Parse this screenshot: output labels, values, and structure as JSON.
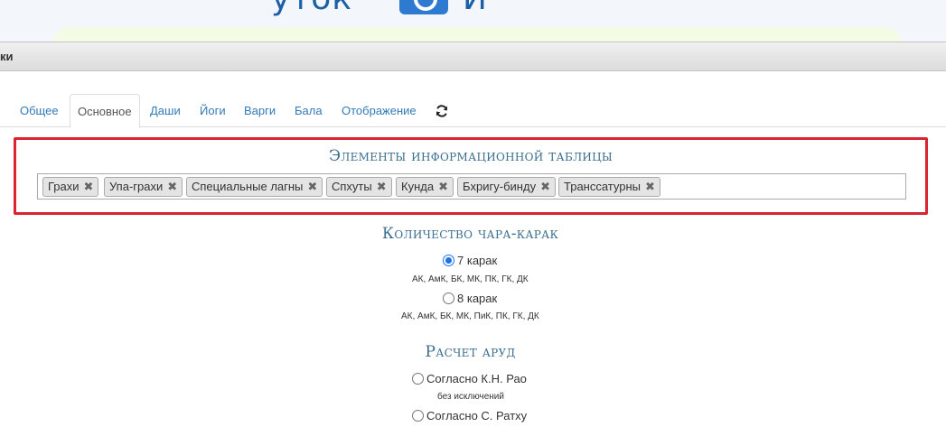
{
  "banner": {
    "brand_left": "уток",
    "brand_right": "И"
  },
  "dialog": {
    "title": "ки"
  },
  "tabs": {
    "left_fragment": "-",
    "items": [
      {
        "label": "Общее"
      },
      {
        "label": "Основное"
      },
      {
        "label": "Даши"
      },
      {
        "label": "Йоги"
      },
      {
        "label": "Варги"
      },
      {
        "label": "Бала"
      },
      {
        "label": "Отображение"
      }
    ],
    "active_index": 1
  },
  "info_table": {
    "heading": "Элементы информационной таблицы",
    "tags": [
      {
        "label": "Грахи"
      },
      {
        "label": "Упа-грахи"
      },
      {
        "label": "Специальные лагны"
      },
      {
        "label": "Спхуты"
      },
      {
        "label": "Кунда"
      },
      {
        "label": "Бхригу-бинду"
      },
      {
        "label": "Транссатурны"
      }
    ],
    "remove_glyph": "✖"
  },
  "chara_karaka": {
    "heading": "Количество чара-карак",
    "options": [
      {
        "label": "7 карак",
        "hint": "АК, АмК, БК, МК, ПК, ГК, ДК",
        "checked": true
      },
      {
        "label": "8 карак",
        "hint": "АК, АмК, БК, МК, ПиК, ПК, ГК, ДК",
        "checked": false
      }
    ]
  },
  "arudha": {
    "heading": "Расчет аруд",
    "options": [
      {
        "label": "Согласно К.Н. Рао",
        "hint": "без исключений",
        "checked": false
      },
      {
        "label": "Согласно С. Ратху",
        "hint": "",
        "checked": false
      }
    ]
  },
  "colors": {
    "accent_link": "#337ab7",
    "heading": "#3b6e8f",
    "highlight_border": "#d9252f"
  }
}
